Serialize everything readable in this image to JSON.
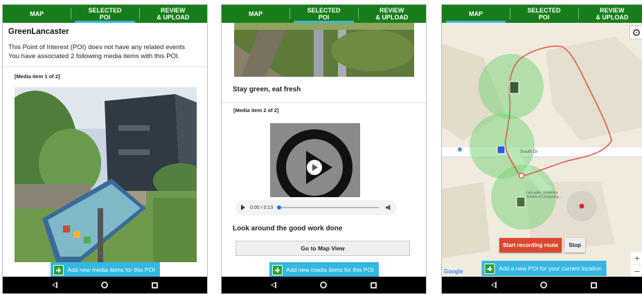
{
  "tabs": [
    {
      "line1": "MAP",
      "line2": ""
    },
    {
      "line1": "SELECTED",
      "line2": "POI"
    },
    {
      "line1": "REVIEW",
      "line2": "& UPLOAD"
    }
  ],
  "panel1": {
    "active_tab": "SELECTED POI",
    "title": "GreenLancaster",
    "line1": "This Point of Interest (POI) does not have any related events",
    "line2": "You have associated 2 following media items with this POI.",
    "media_label": "[Media item 1 of 2]",
    "add_button": "Add new media items for this POI"
  },
  "panel2": {
    "active_tab": "SELECTED POI",
    "caption1": "Stay green, eat fresh",
    "media_label": "[Media item 2 of 2]",
    "audio_time": "0:00 / 0:13",
    "audio_progress": 0,
    "caption2": "Look around the good work done",
    "go_map_button": "Go to Map View",
    "add_button": "Add new media items for this POI"
  },
  "panel3": {
    "active_tab": "MAP",
    "street_label": "South Dr",
    "poi_label_line1": "Lancaster University",
    "poi_label_line2": "School of Computing...",
    "start_button": "Start recording route",
    "stop_button": "Stop",
    "add_button": "Add a new POI for your current location",
    "google_logo": "Google",
    "zoom_in": "+",
    "zoom_out": "−"
  },
  "colors": {
    "header_green": "#177d1b",
    "tab_indicator": "#38b7e6",
    "add_button_blue": "#34b7e0",
    "record_red": "#d9492f",
    "route_red": "#e25a4b",
    "poi_circle": "#7ed37e"
  },
  "icons": {
    "nav_back": "back-triangle-icon",
    "nav_home": "home-circle-icon",
    "nav_recent": "recent-square-icon",
    "add": "plus-icon",
    "locate": "my-location-icon",
    "play": "play-icon",
    "volume": "volume-icon"
  }
}
